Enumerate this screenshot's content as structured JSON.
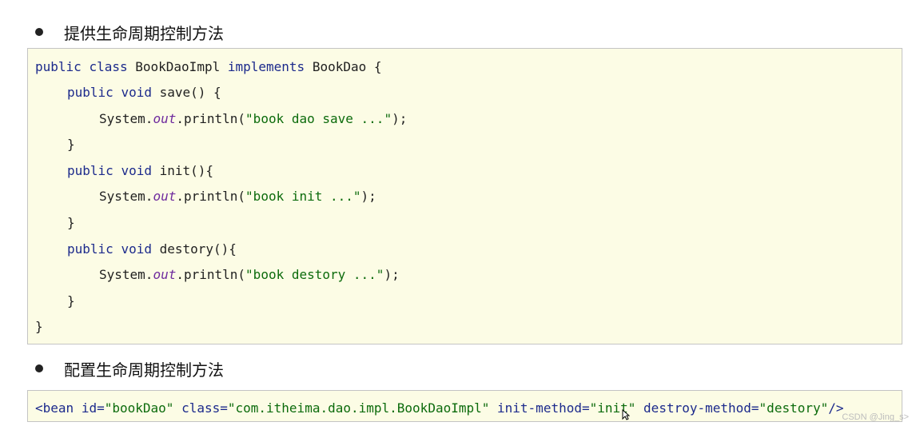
{
  "section1": {
    "heading": "提供生命周期控制方法"
  },
  "code1": {
    "l1": {
      "kw1": "public",
      "kw2": "class",
      "name": "BookDaoImpl",
      "kw3": "implements",
      "iface": "BookDao",
      "brace": "{"
    },
    "l2": {
      "kw1": "public",
      "kw2": "void",
      "sig": "save() {"
    },
    "l3": {
      "obj": "System.",
      "field": "out",
      "call": ".println(",
      "str": "\"book dao save ...\"",
      "end": ");"
    },
    "l4": {
      "brace": "}"
    },
    "l5": {
      "kw1": "public",
      "kw2": "void",
      "sig": "init(){"
    },
    "l6": {
      "obj": "System.",
      "field": "out",
      "call": ".println(",
      "str": "\"book init ...\"",
      "end": ");"
    },
    "l7": {
      "brace": "}"
    },
    "l8": {
      "kw1": "public",
      "kw2": "void",
      "sig": "destory(){"
    },
    "l9": {
      "obj": "System.",
      "field": "out",
      "call": ".println(",
      "str": "\"book destory ...\"",
      "end": ");"
    },
    "l10": {
      "brace": "}"
    },
    "l11": {
      "brace": "}"
    }
  },
  "section2": {
    "heading": "配置生命周期控制方法"
  },
  "code2": {
    "tag_open": "<bean",
    "a1": "id=",
    "v1": "\"bookDao\"",
    "a2": "class=",
    "v2": "\"com.itheima.dao.impl.BookDaoImpl\"",
    "a3": "init-method=",
    "v3": "\"init\"",
    "a4": "destroy-method=",
    "v4": "\"destory\"",
    "tag_close": "/>"
  },
  "watermark": "CSDN @Jing_s>",
  "colors": {
    "keyword": "#1c2a8c",
    "string": "#0c6b0c",
    "field": "#6f2b9e",
    "code_bg": "#fcfce5"
  }
}
